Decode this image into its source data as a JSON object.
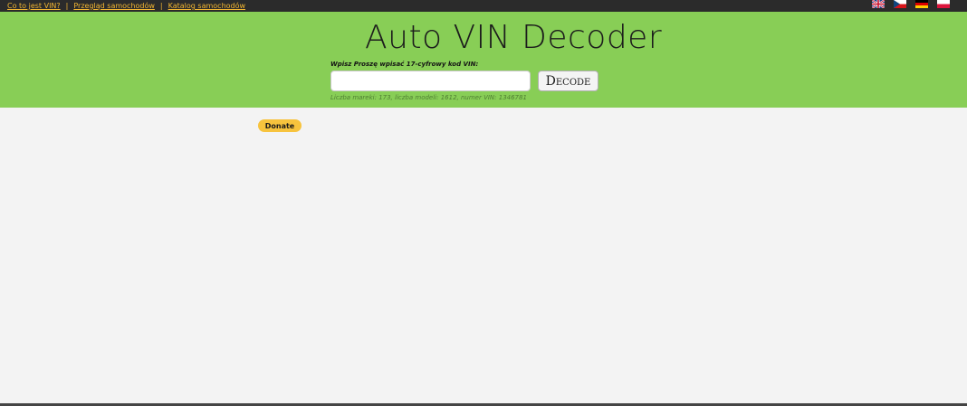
{
  "topnav": {
    "links": [
      {
        "label": "Co to jest VIN?"
      },
      {
        "label": "Przegląd samochodów"
      },
      {
        "label": "Katalog samochodów"
      }
    ],
    "separator": "|",
    "link_color": "#f2b632",
    "background_color": "#2b2b2b"
  },
  "languages": [
    "english-flag-icon",
    "czech-flag-icon",
    "german-flag-icon",
    "polish-flag-icon"
  ],
  "hero": {
    "title": "Auto VIN Decoder",
    "prompt": "Wpisz Proszę wpisać 17-cyfrowy kod VIN:",
    "vin_value": "",
    "decode_label": "Decode",
    "stats": "Liczba mareki: 173, liczba modeli: 1612, numer VIN: 1346781",
    "background_color": "#88ce56"
  },
  "donate": {
    "label": "Donate",
    "color": "#f7c33d"
  }
}
